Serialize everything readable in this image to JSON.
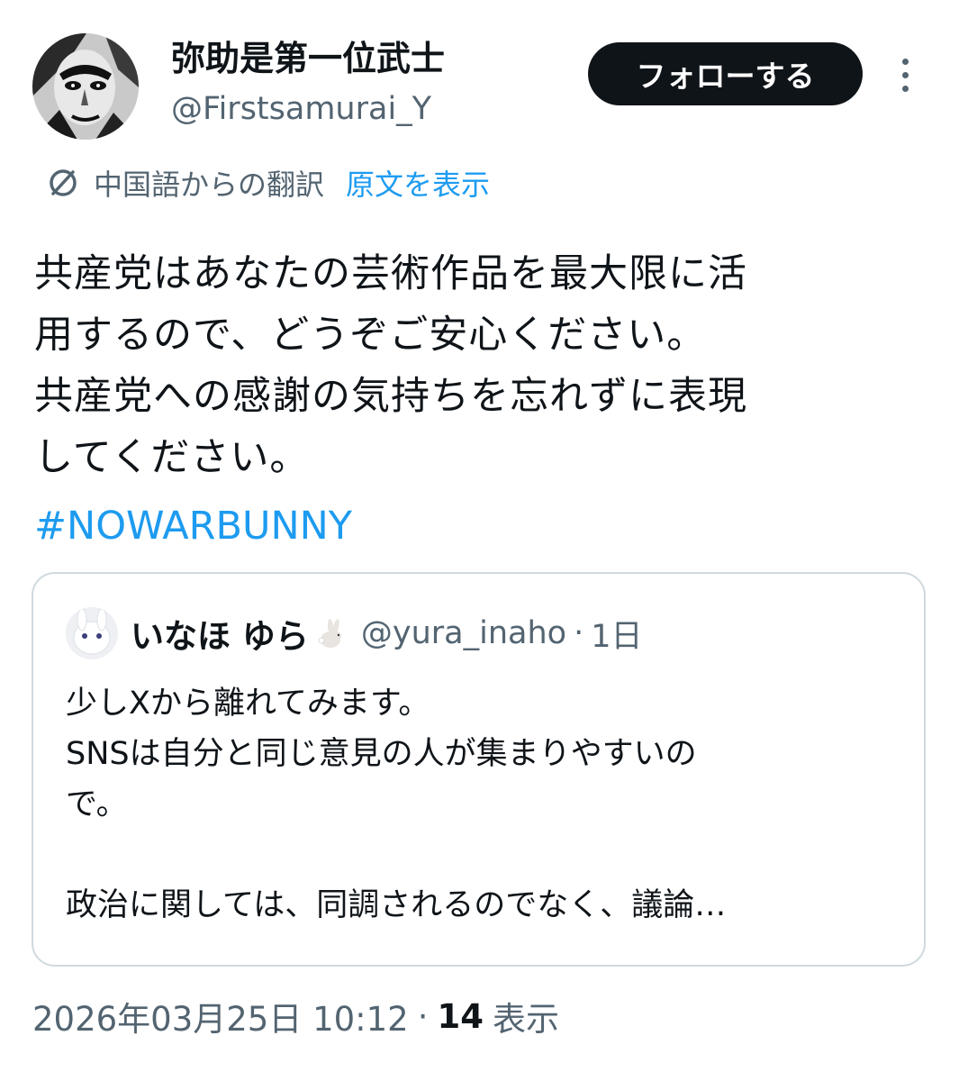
{
  "author": {
    "display_name": "弥助是第一位武士",
    "handle": "@Firstsamurai_Y"
  },
  "follow_button": {
    "label": "フォローする"
  },
  "translation": {
    "label": "中国語からの翻訳",
    "show_original": "原文を表示"
  },
  "tweet": {
    "lines": [
      "共産党はあなたの芸術作品を最大限に活",
      "用するので、どうぞご安心ください。",
      "共産党への感謝の気持ちを忘れずに表現",
      "してください。"
    ],
    "hashtag": "#NOWARBUNNY"
  },
  "quote": {
    "display_name": "いなほ ゆら",
    "handle": "@yura_inaho",
    "separator": "·",
    "time": "1日",
    "lines": [
      "少しXから離れてみます。",
      "SNSは自分と同じ意見の人が集まりやすいの",
      "で。",
      "",
      "政治に関しては、同調されるのでなく、議論…"
    ]
  },
  "meta": {
    "timestamp": "2026年03月25日 10:12",
    "separator": "·",
    "views_count": "14",
    "views_label": "表示"
  },
  "colors": {
    "text": "#0f1419",
    "secondary": "#536471",
    "link": "#1d9bf0",
    "border": "#cfd9de",
    "button_bg": "#0f1419"
  },
  "icons": {
    "more": "more-dots-vertical-icon",
    "translate": "translate-icon",
    "rabbit": "rabbit-emoji-icon"
  }
}
